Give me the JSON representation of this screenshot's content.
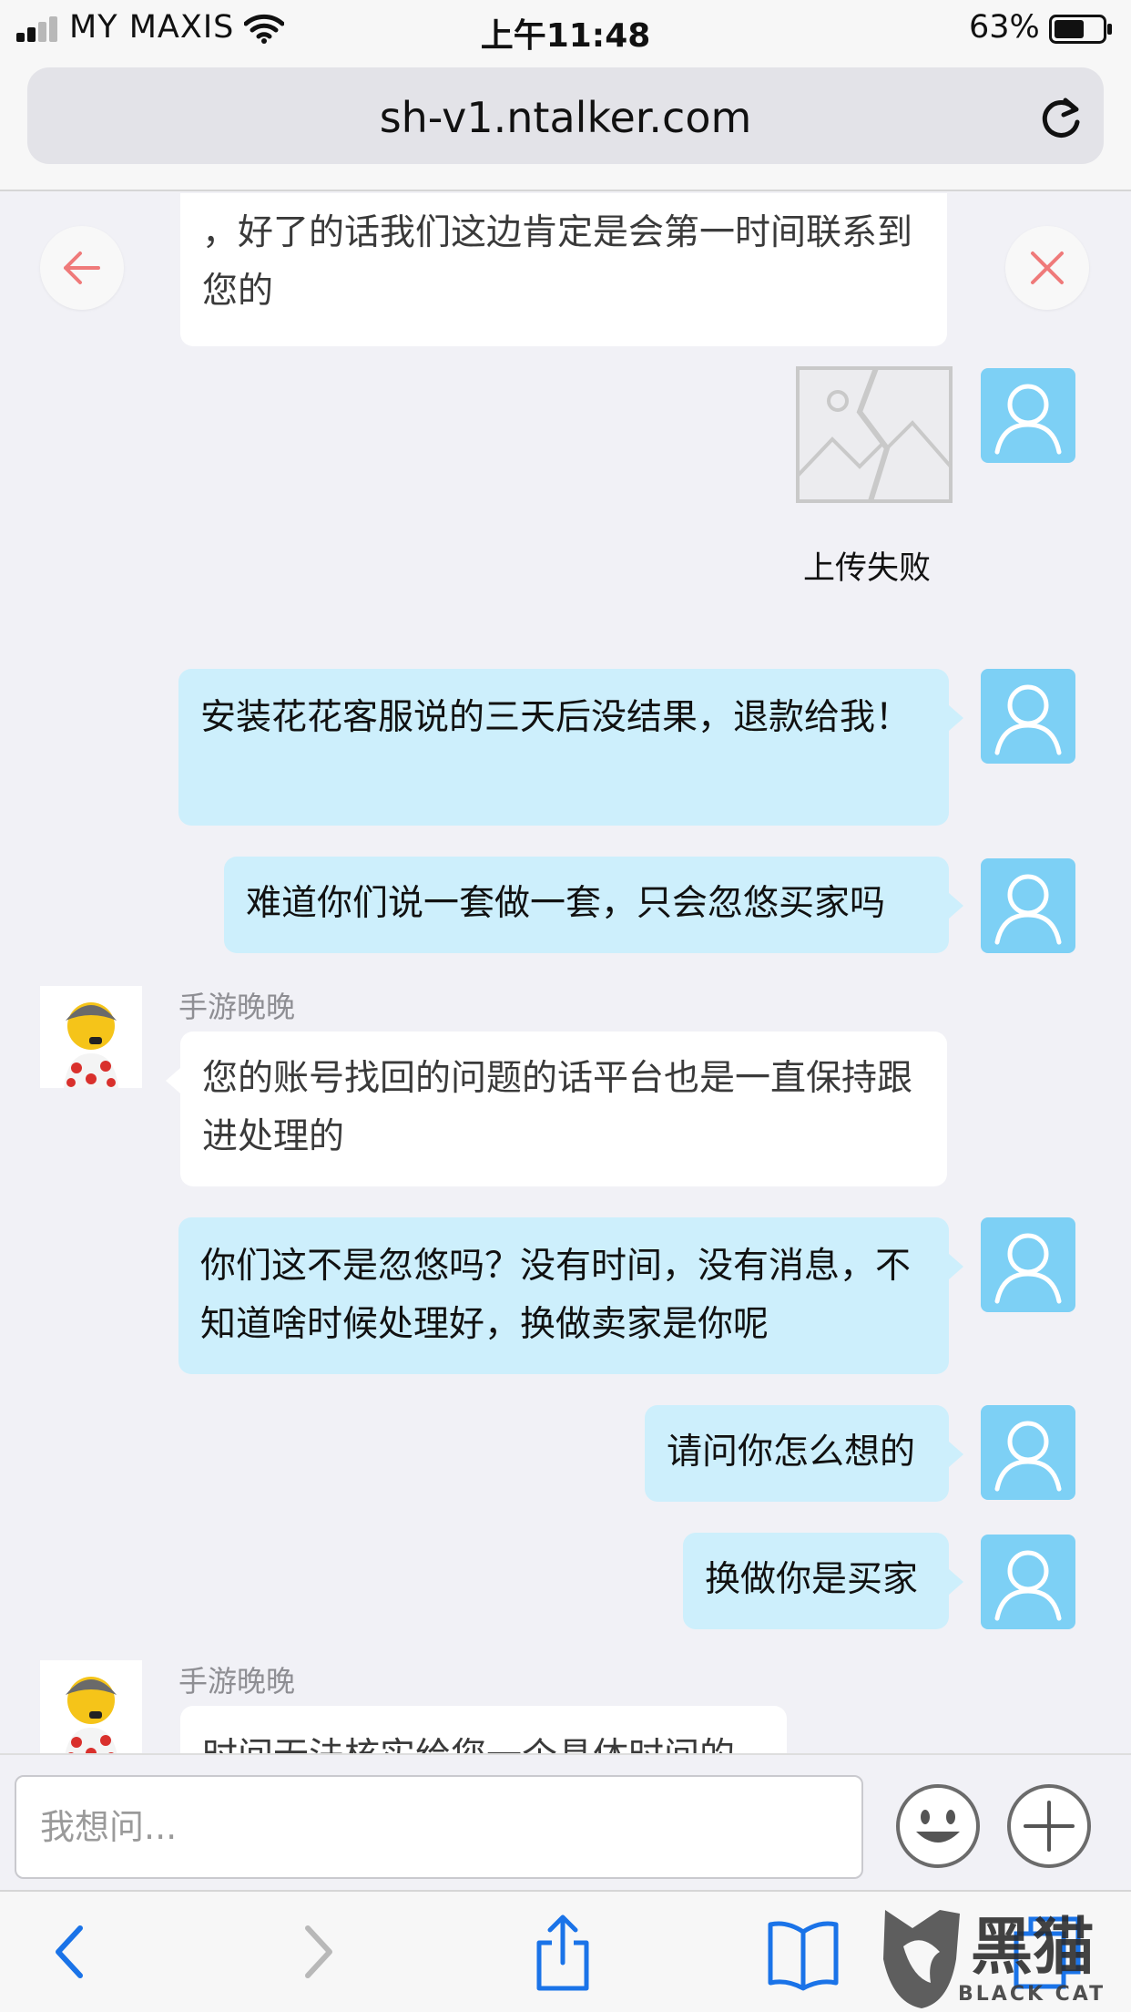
{
  "status_bar": {
    "carrier": "MY MAXIS",
    "time": "上午11:48",
    "battery_percent": "63%",
    "battery_level": 0.63
  },
  "browser": {
    "url": "sh-v1.ntalker.com"
  },
  "chat": {
    "agent_name": "手游晚晚",
    "upload_failed_label": "上传失败",
    "messages": [
      {
        "from": "agent",
        "text": "，好了的话我们这边肯定是会第一时间联系到您的"
      },
      {
        "from": "user",
        "text": "安装花花客服说的三天后没结果，退款给我！"
      },
      {
        "from": "user",
        "text": "难道你们说一套做一套，只会忽悠买家吗"
      },
      {
        "from": "agent",
        "text": "您的账号找回的问题的话平台也是一直保持跟进处理的"
      },
      {
        "from": "user",
        "text": "你们这不是忽悠吗？没有时间，没有消息，不知道啥时候处理好，换做卖家是你呢"
      },
      {
        "from": "user",
        "text": "请问你怎么想的"
      },
      {
        "from": "user",
        "text": "换做你是买家"
      },
      {
        "from": "agent",
        "text": "时间无法核实给您一个具体时间的"
      }
    ]
  },
  "composer": {
    "placeholder": "我想问..."
  },
  "watermark": {
    "text": "BLACK CAT",
    "glyph": "黑猫"
  },
  "colors": {
    "user_bubble": "#cdeffc",
    "agent_bubble": "#ffffff",
    "avatar_blue": "#7dd0f5",
    "toolbar_blue": "#1a73e8",
    "close_red": "#f08080"
  },
  "icons": {
    "back": "arrow-left-icon",
    "close": "close-icon",
    "emoji": "smiley-icon",
    "plus": "plus-icon",
    "reload": "reload-icon"
  }
}
